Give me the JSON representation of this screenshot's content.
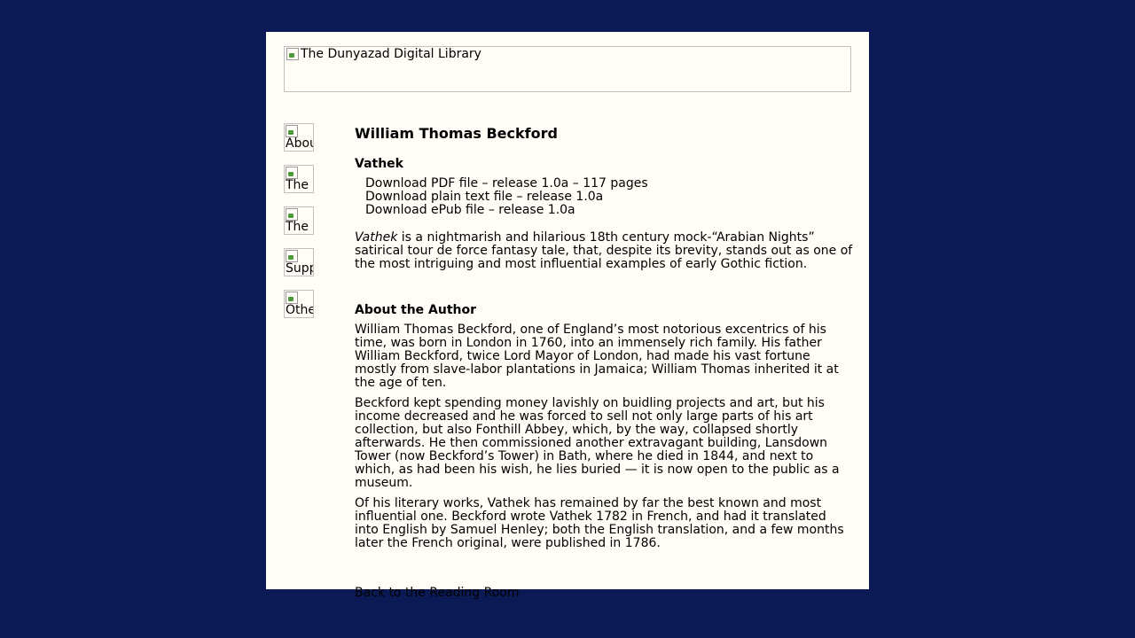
{
  "banner": {
    "alt": "The Dunyazad Digital Library"
  },
  "nav": [
    {
      "alt": "About"
    },
    {
      "alt": "The"
    },
    {
      "alt": "The"
    },
    {
      "alt": "Supp"
    },
    {
      "alt": "Othe"
    }
  ],
  "main": {
    "author": "William Thomas Beckford",
    "book_title": "Vathek",
    "downloads": [
      "Download PDF file – release 1.0a – 117 pages",
      "Download plain text file – release 1.0a",
      "Download ePub file – release 1.0a"
    ],
    "intro_title": "Vathek",
    "intro_rest": " is a nightmarish and hilarious 18th century mock-“Arabian Nights” satirical tour de force fantasy tale, that, despite its brevity, stands out as one of the most intriguing and most influential examples of early Gothic fiction.",
    "about_heading": "About the Author",
    "paragraphs": [
      "William Thomas Beckford, one of England’s most notorious excentrics of his time, was born in London in 1760, into an immensely rich family. His father William Beckford, twice Lord Mayor of London, had made his vast fortune mostly from slave-labor plantations in Jamaica; William Thomas inherited it at the age of ten.",
      "Beckford kept spending money lavishly on buidling projects and art, but his income decreased and he was forced to sell not only large parts of his art collection, but also Fonthill Abbey, which, by the way, collapsed shortly afterwards. He then commissioned another extravagant building, Lansdown Tower (now Beckford’s Tower) in Bath, where he died in 1844, and next to which, as had been his wish, he lies buried — it is now open to the public as a museum.",
      "Of his literary works, Vathek has remained by far the best known and most influential one. Beckford wrote Vathek 1782 in French, and had it translated into English by Samuel Henley; both the English translation, and a few months later the French original, were published in 1786."
    ],
    "back_link": "Back to the Reading Room"
  },
  "colors": {
    "outer_background": "#0b1a54",
    "page_background": "#fffdf5"
  }
}
